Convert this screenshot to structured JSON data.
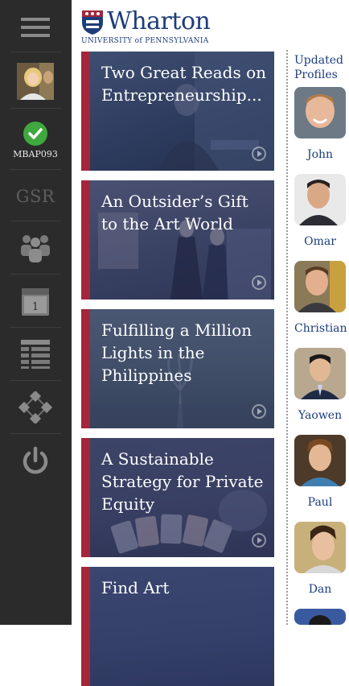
{
  "app": {
    "name": "Wharton"
  },
  "header": {
    "logo_word": "Wharton",
    "logo_sub": "UNIVERSITY of PENNSYLVANIA"
  },
  "sidebar": {
    "items": [
      {
        "icon": "menu-icon"
      },
      {
        "icon": "avatar"
      },
      {
        "icon": "check-icon",
        "label": "MBAP093",
        "color": "#3fa83f"
      },
      {
        "icon": "gsr",
        "label": "GSR"
      },
      {
        "icon": "people-icon"
      },
      {
        "icon": "calendar-icon",
        "label": "1"
      },
      {
        "icon": "table-icon"
      },
      {
        "icon": "network-icon"
      },
      {
        "icon": "power-icon"
      }
    ]
  },
  "articles": [
    {
      "title": "Two Great Reads on Entrepreneurship...",
      "color": "#324063"
    },
    {
      "title": "An Outsider’s Gift to the Art World",
      "color": "#3a4264"
    },
    {
      "title": "Fulfilling a Million Lights in the Philippines",
      "color": "#3e4c66"
    },
    {
      "title": "A Sustainable Strategy for Private Equity",
      "color": "#383f63"
    },
    {
      "title": "Find Art",
      "color": "#34406a"
    }
  ],
  "profiles": {
    "heading": "Updated Profiles",
    "people": [
      {
        "name": "John"
      },
      {
        "name": "Omar"
      },
      {
        "name": "Christian"
      },
      {
        "name": "Yaowen"
      },
      {
        "name": "Paul"
      },
      {
        "name": "Dan"
      }
    ]
  },
  "colors": {
    "brand_blue": "#1d3d7a",
    "accent_red": "#a3263a",
    "sidebar_bg": "#2b2b2b"
  }
}
